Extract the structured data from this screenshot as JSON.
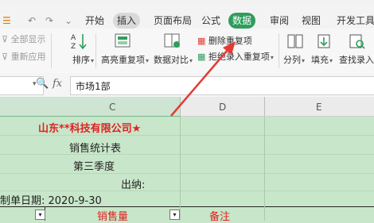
{
  "ribbon": {
    "tabs": [
      {
        "label": "开始",
        "state": "normal"
      },
      {
        "label": "插入",
        "state": "pill"
      },
      {
        "label": "页面布局",
        "state": "normal"
      },
      {
        "label": "公式",
        "state": "normal"
      },
      {
        "label": "数据",
        "state": "active"
      },
      {
        "label": "审阅",
        "state": "normal"
      },
      {
        "label": "视图",
        "state": "normal"
      },
      {
        "label": "开发工具",
        "state": "normal"
      }
    ],
    "tools": {
      "show_all": "全部显示",
      "reapply": "重新应用",
      "sort": "排序",
      "highlight_dup": "高亮重复项",
      "data_compare": "数据对比",
      "remove_dup": "删除重复项",
      "reject_dup": "拒绝录入重复项",
      "split": "分列",
      "fill": "填充",
      "find_entry": "查找录入"
    }
  },
  "formula_bar": {
    "fx": "fx",
    "value": "市场1部"
  },
  "columns": [
    "C",
    "D",
    "E"
  ],
  "sheet": {
    "company": "山东**科技有限公司★",
    "title": "销售统计表",
    "quarter": "第三季度",
    "cashier": "出纳:",
    "date_line": "制单日期: 2020-9-30",
    "header_sales": "销售量",
    "header_notes": "备注"
  },
  "colors": {
    "accent_green": "#2f9d5c",
    "sheet_bg": "#c8e6c9",
    "red_text": "#e02020",
    "arrow": "#e53935"
  }
}
